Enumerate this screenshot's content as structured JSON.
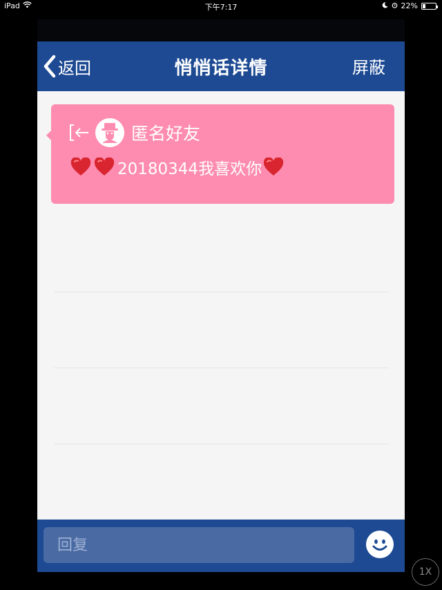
{
  "status_bar": {
    "device": "iPad",
    "time": "下午7:17",
    "battery": "22%",
    "battery_level": 0.22
  },
  "nav": {
    "back_label": "返回",
    "title": "悄悄话详情",
    "block_label": "屏蔽"
  },
  "message": {
    "sender": "匿名好友",
    "text": "20180344我喜欢你",
    "bubble_color": "#fd8cb0"
  },
  "reply": {
    "placeholder": "回复"
  },
  "zoom": {
    "label": "1X"
  },
  "colors": {
    "nav_bg": "#1d4a93",
    "input_bg": "#4a6aa4",
    "heart": "#d9252f"
  },
  "icons": [
    "wifi-icon",
    "moon-icon",
    "alarm-icon",
    "battery-icon",
    "back-chevron-icon",
    "exit-arrow-icon",
    "anonymous-avatar-icon",
    "heart-icon",
    "smiley-icon"
  ]
}
